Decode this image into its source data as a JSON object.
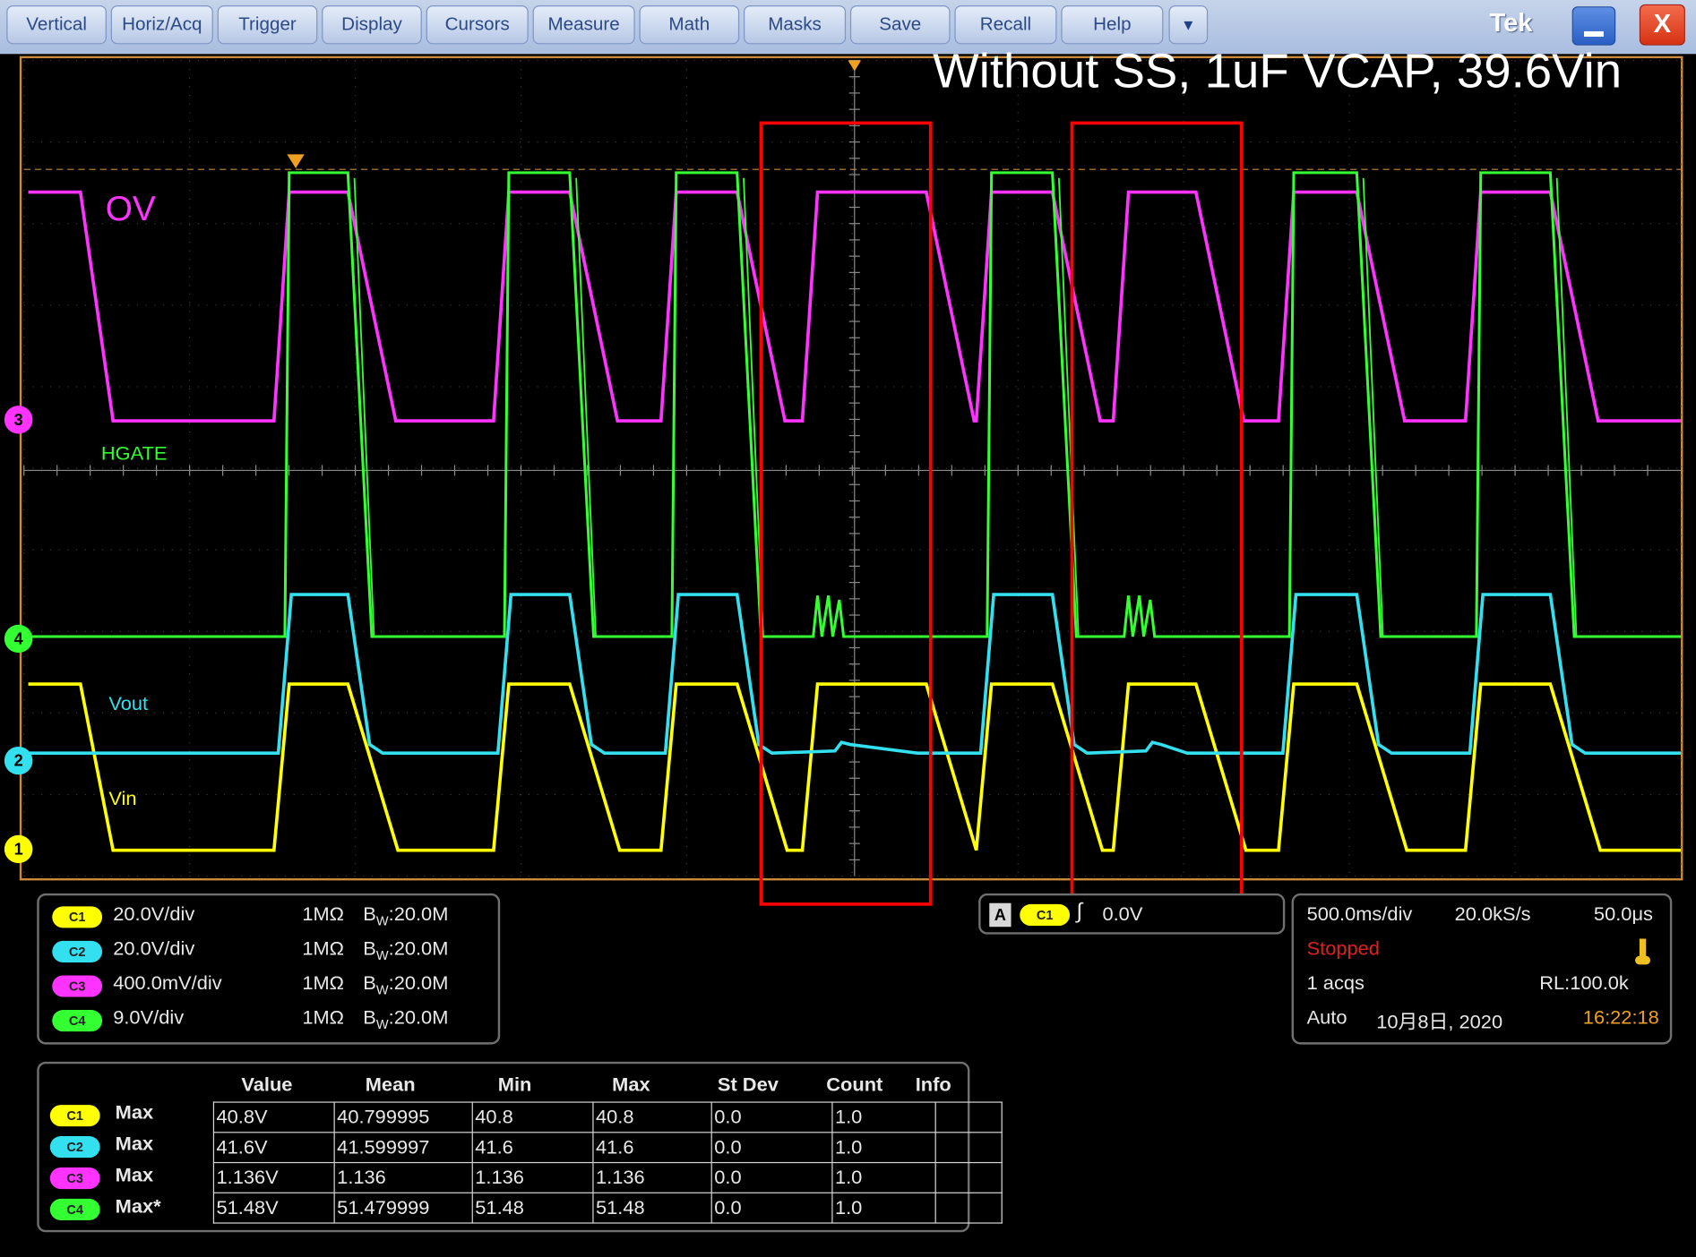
{
  "menu": {
    "items": [
      "Vertical",
      "Horiz/Acq",
      "Trigger",
      "Display",
      "Cursors",
      "Measure",
      "Math",
      "Masks",
      "Save",
      "Recall",
      "Help"
    ],
    "dropdown_icon": "triangle-down",
    "brand": "Tek",
    "minimize_icon": "minimize",
    "close_label": "X"
  },
  "annotation": "Without SS, 1uF VCAP, 39.6Vin",
  "trace_labels": {
    "ov": "OV",
    "hgate": "HGATE",
    "vout": "Vout",
    "vin": "Vin"
  },
  "channel_markers": [
    "3",
    "4",
    "2",
    "1"
  ],
  "colors": {
    "ch1": "#ffff00",
    "ch2": "#33e0f0",
    "ch3": "#ff33ff",
    "ch4": "#33ff33",
    "highlight_box": "#ff0000",
    "graticule_border": "#c8893a"
  },
  "channels": [
    {
      "badge": "C1",
      "scale": "20.0V/div",
      "impedance": "1MΩ",
      "bw_prefix": "B",
      "bw_sub": "W",
      "bw_value": ":20.0M"
    },
    {
      "badge": "C2",
      "scale": "20.0V/div",
      "impedance": "1MΩ",
      "bw_prefix": "B",
      "bw_sub": "W",
      "bw_value": ":20.0M"
    },
    {
      "badge": "C3",
      "scale": "400.0mV/div",
      "impedance": "1MΩ",
      "bw_prefix": "B",
      "bw_sub": "W",
      "bw_value": ":20.0M"
    },
    {
      "badge": "C4",
      "scale": "9.0V/div",
      "impedance": "1MΩ",
      "bw_prefix": "B",
      "bw_sub": "W",
      "bw_value": ":20.0M"
    }
  ],
  "trigger": {
    "mode": "A",
    "source": "C1",
    "level": "0.0V"
  },
  "acquisition": {
    "timebase": "500.0ms/div",
    "sample_rate": "20.0kS/s",
    "resolution": "50.0μs",
    "state": "Stopped",
    "acqs": "1 acqs",
    "record_length": "RL:100.0k",
    "trigger_mode": "Auto",
    "date": "10月8日, 2020",
    "time": "16:22:18"
  },
  "measurements": {
    "headers": [
      "Value",
      "Mean",
      "Min",
      "Max",
      "St Dev",
      "Count",
      "Info"
    ],
    "rows": [
      {
        "badge": "C1",
        "type": "Max",
        "value": "40.8V",
        "mean": "40.799995",
        "min": "40.8",
        "max": "40.8",
        "stdev": "0.0",
        "count": "1.0",
        "info": ""
      },
      {
        "badge": "C2",
        "type": "Max",
        "value": "41.6V",
        "mean": "41.599997",
        "min": "41.6",
        "max": "41.6",
        "stdev": "0.0",
        "count": "1.0",
        "info": ""
      },
      {
        "badge": "C3",
        "type": "Max",
        "value": "1.136V",
        "mean": "1.136",
        "min": "1.136",
        "max": "1.136",
        "stdev": "0.0",
        "count": "1.0",
        "info": ""
      },
      {
        "badge": "C4",
        "type": "Max*",
        "value": "51.48V",
        "mean": "51.479999",
        "min": "51.48",
        "max": "51.48",
        "stdev": "0.0",
        "count": "1.0",
        "info": ""
      }
    ]
  }
}
